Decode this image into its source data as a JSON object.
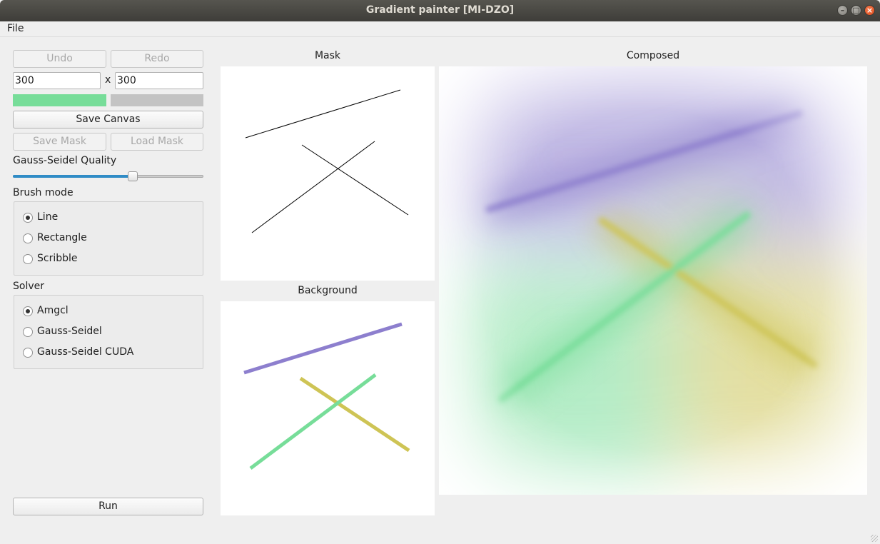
{
  "window": {
    "title": "Gradient painter [MI-DZO]"
  },
  "menu": {
    "file": "File"
  },
  "toolbar": {
    "undo": "Undo",
    "redo": "Redo",
    "width": "300",
    "height": "300",
    "times": "x",
    "save_canvas": "Save Canvas",
    "save_mask": "Save Mask",
    "load_mask": "Load Mask",
    "primary_color": "#77dd99",
    "secondary_color": "#c3c3c3"
  },
  "quality": {
    "label": "Gauss-Seidel Quality",
    "value_fraction": 0.63
  },
  "brush": {
    "label": "Brush mode",
    "options": [
      "Line",
      "Rectangle",
      "Scribble"
    ],
    "selected": "Line"
  },
  "solver": {
    "label": "Solver",
    "options": [
      "Amgcl",
      "Gauss-Seidel",
      "Gauss-Seidel CUDA"
    ],
    "selected": "Amgcl"
  },
  "run": "Run",
  "panels": {
    "mask": "Mask",
    "background": "Background",
    "composed": "Composed"
  },
  "colors": {
    "purple": "#8d7fce",
    "green": "#77dd99",
    "yellow": "#cec455"
  }
}
